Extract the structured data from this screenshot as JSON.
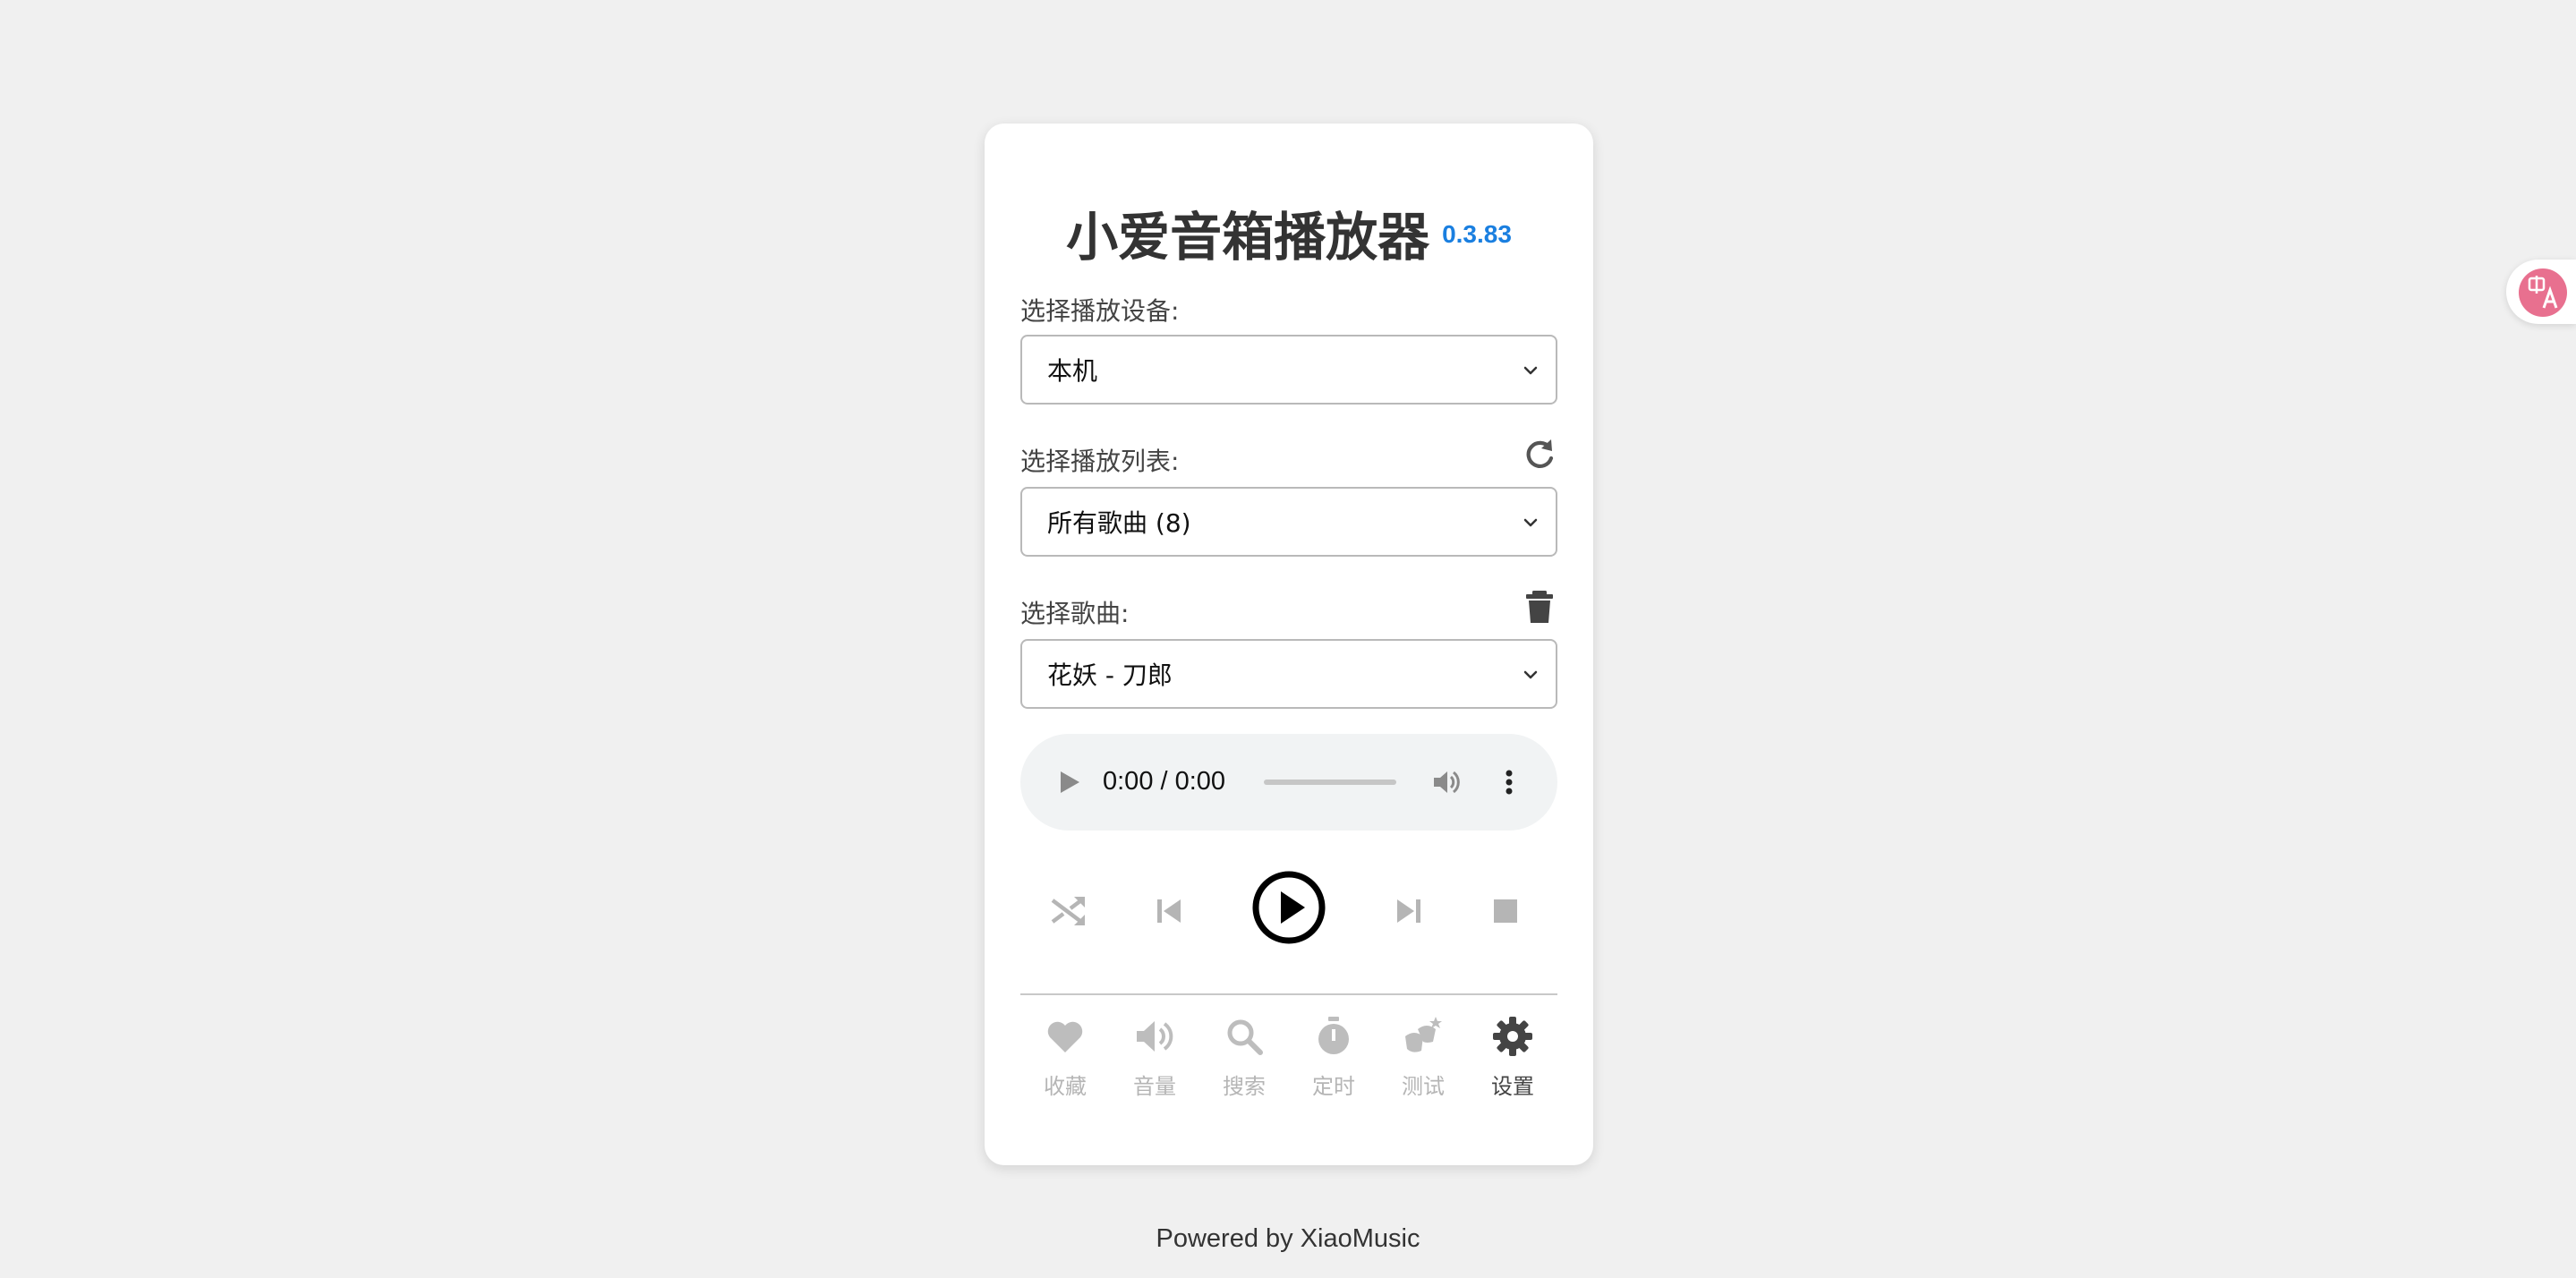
{
  "app": {
    "title": "小爱音箱播放器",
    "version": "0.3.83"
  },
  "device": {
    "label": "选择播放设备:",
    "selected": "本机"
  },
  "playlist": {
    "label": "选择播放列表:",
    "selected": "所有歌曲 (8)",
    "refresh_icon": "refresh-icon"
  },
  "song": {
    "label": "选择歌曲:",
    "selected": "花妖 - 刀郎",
    "delete_icon": "trash-icon"
  },
  "audio": {
    "time": "0:00 / 0:00",
    "progress": 0
  },
  "controls": {
    "shuffle_icon": "shuffle-icon",
    "prev_icon": "skip-previous-icon",
    "play_icon": "play-circle-icon",
    "next_icon": "skip-next-icon",
    "stop_icon": "stop-icon"
  },
  "nav": {
    "items": [
      {
        "label": "收藏",
        "icon": "heart-icon"
      },
      {
        "label": "音量",
        "icon": "volume-icon"
      },
      {
        "label": "搜索",
        "icon": "search-icon"
      },
      {
        "label": "定时",
        "icon": "timer-icon"
      },
      {
        "label": "测试",
        "icon": "test-icon"
      },
      {
        "label": "设置",
        "icon": "gear-icon"
      }
    ],
    "active_index": 5
  },
  "footer": {
    "text": "Powered by XiaoMusic"
  },
  "colors": {
    "accent": "#1a7fe0",
    "background": "#f0f0f0",
    "translate_badge": "#e8708f"
  }
}
